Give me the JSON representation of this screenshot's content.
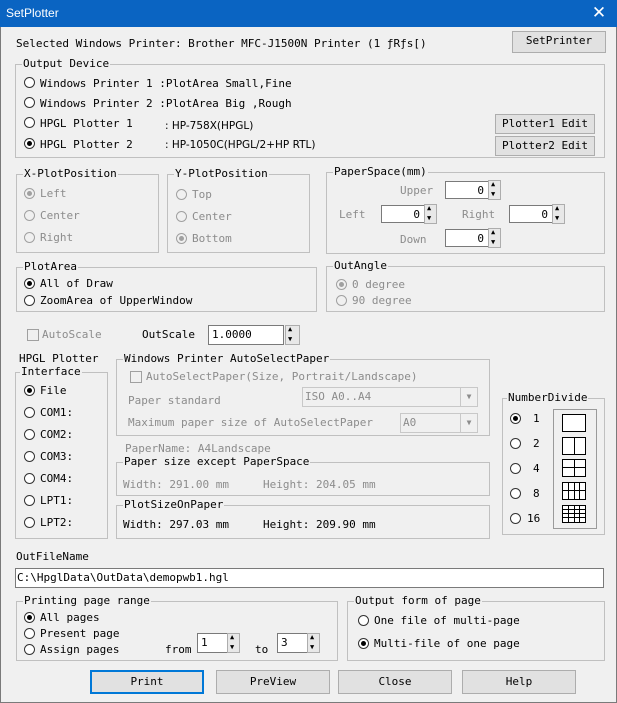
{
  "window": {
    "title": "SetPlotter",
    "close_glyph": "✕"
  },
  "printer": {
    "label": "Selected Windows Printer: Brother MFC-J1500N Printer (1 ƒRƒs[)",
    "set_button": "SetPrinter"
  },
  "output_device": {
    "legend": "Output Device",
    "options": [
      {
        "label": "Windows Printer 1 :PlotArea Small,Fine",
        "detail": "",
        "selected": false
      },
      {
        "label": "Windows Printer 2 :PlotArea Big  ,Rough",
        "detail": "",
        "selected": false
      },
      {
        "label": "HPGL Plotter 1",
        "detail": ": HP-758X(HPGL)",
        "selected": false
      },
      {
        "label": "HPGL Plotter 2",
        "detail": ": HP-1050C(HPGL/2+HP RTL)",
        "selected": true
      }
    ],
    "plotter1_edit": "Plotter1 Edit",
    "plotter2_edit": "Plotter2 Edit"
  },
  "x_plot_position": {
    "legend": "X-PlotPosition",
    "options": [
      "Left",
      "Center",
      "Right"
    ],
    "selected": 0
  },
  "y_plot_position": {
    "legend": "Y-PlotPosition",
    "options": [
      "Top",
      "Center",
      "Bottom"
    ],
    "selected": 2
  },
  "paper_space": {
    "legend": "PaperSpace(mm)",
    "upper_label": "Upper",
    "upper": "0",
    "left_label": "Left",
    "left": "0",
    "right_label": "Right",
    "right": "0",
    "down_label": "Down",
    "down": "0"
  },
  "plot_area": {
    "legend": "PlotArea",
    "options": [
      "All of Draw",
      "ZoomArea of UpperWindow"
    ],
    "selected": 0
  },
  "out_angle": {
    "legend": "OutAngle",
    "options": [
      "0 degree",
      "90 degree"
    ],
    "selected": 0
  },
  "auto_scale": {
    "label": "AutoScale",
    "out_scale_label": "OutScale",
    "out_scale": "1.0000"
  },
  "hpgl_interface": {
    "legend_line1": "HPGL Plotter",
    "legend_line2": "Interface",
    "options": [
      "File",
      "COM1:",
      "COM2:",
      "COM3:",
      "COM4:",
      "LPT1:",
      "LPT2:"
    ],
    "selected": 0
  },
  "auto_select_paper": {
    "legend": "Windows Printer AutoSelectPaper",
    "checkbox_label": "AutoSelectPaper(Size, Portrait/Landscape)",
    "paper_standard_label": "Paper standard",
    "paper_standard": "ISO A0..A4",
    "max_size_label": "Maximum paper size of AutoSelectPaper",
    "max_size": "A0",
    "paper_name": "PaperName:  A4Landscape"
  },
  "paper_except": {
    "legend": "Paper size except PaperSpace",
    "width": "Width: 291.00 mm",
    "height": "Height: 204.05 mm"
  },
  "plot_size": {
    "legend": "PlotSizeOnPaper",
    "width": "Width: 297.03 mm",
    "height": "Height: 209.90 mm"
  },
  "number_divide": {
    "legend": "NumberDivide",
    "options": [
      "1",
      "2",
      "4",
      "8",
      "16"
    ],
    "selected": 0
  },
  "out_file": {
    "label": "OutFileName",
    "value": "C:\\HpglData\\OutData\\demopwb1.hgl"
  },
  "page_range": {
    "legend": "Printing page range",
    "options": [
      "All pages",
      "Present page",
      "Assign pages"
    ],
    "selected": 0,
    "from_label": "from",
    "from": "1",
    "to_label": "to",
    "to": "3"
  },
  "output_form": {
    "legend": "Output form of page",
    "options": [
      "One file of multi-page",
      "Multi-file of one page"
    ],
    "selected": 1
  },
  "buttons": {
    "print": "Print",
    "preview": "PreView",
    "close": "Close",
    "help": "Help"
  }
}
